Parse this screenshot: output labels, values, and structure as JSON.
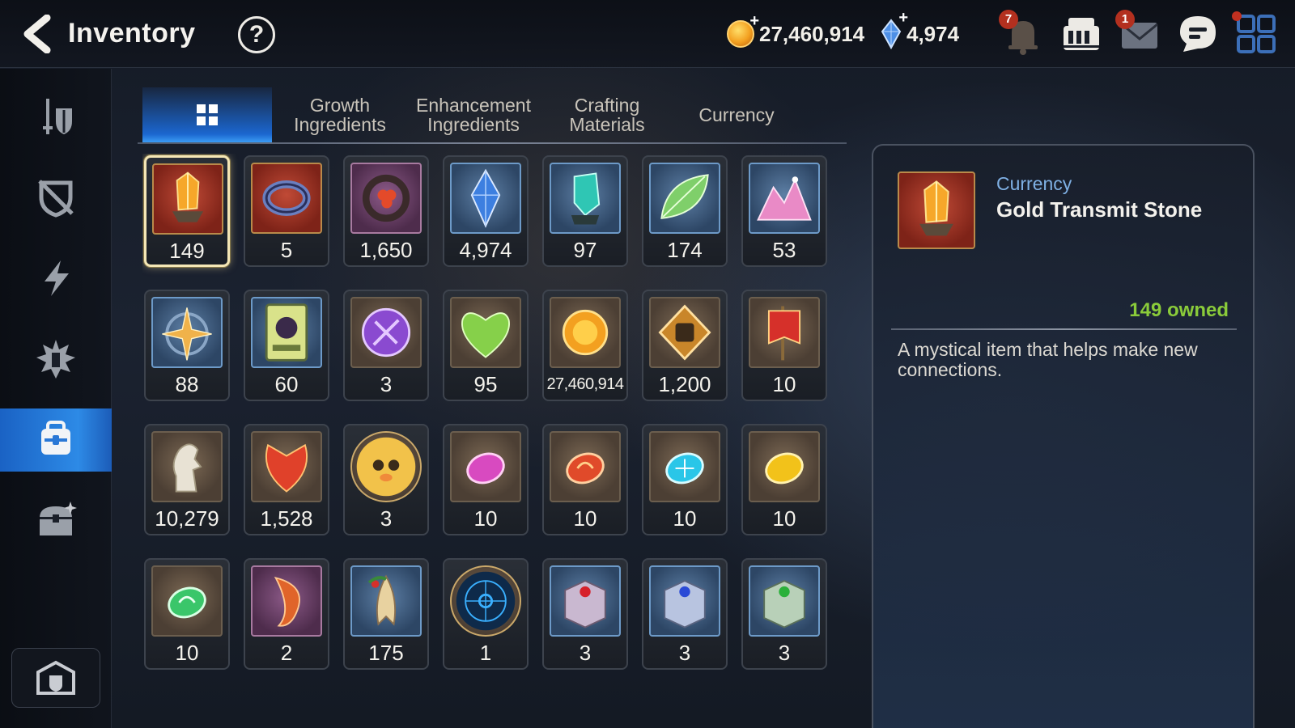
{
  "header": {
    "title": "Inventory",
    "help_label": "?",
    "gold": "27,460,914",
    "gems": "4,974",
    "notification_badge": "7",
    "mail_badge": "1"
  },
  "tabs": [
    {
      "label": "",
      "icon": "grid-icon",
      "active": true
    },
    {
      "label": "Growth\nIngredients"
    },
    {
      "label": "Enhancement\nIngredients"
    },
    {
      "label": "Crafting\nMaterials"
    },
    {
      "label": "Currency"
    }
  ],
  "sidebar": {
    "items": [
      "equipment-icon",
      "no-artifact-icon",
      "lightning-icon",
      "stigma-icon",
      "inventory-bag-icon",
      "chest-icon"
    ],
    "active_index": 4,
    "bottom": "storage-icon"
  },
  "items": [
    {
      "count": "149",
      "icon": "gold-transmit-stone",
      "bg": "red"
    },
    {
      "count": "5",
      "icon": "charm-ring",
      "bg": "red"
    },
    {
      "count": "1,650",
      "icon": "flower-ring",
      "bg": "purple"
    },
    {
      "count": "4,974",
      "icon": "blue-crystal",
      "bg": "blue"
    },
    {
      "count": "97",
      "icon": "teal-crystal",
      "bg": "blue"
    },
    {
      "count": "174",
      "icon": "leaf",
      "bg": "blue"
    },
    {
      "count": "53",
      "icon": "pink-crystal-pile",
      "bg": "blue"
    },
    {
      "count": "88",
      "icon": "star-medal",
      "bg": "blue"
    },
    {
      "count": "60",
      "icon": "summon-card",
      "bg": "blue"
    },
    {
      "count": "3",
      "icon": "purple-seal",
      "bg": "brown"
    },
    {
      "count": "95",
      "icon": "green-heart",
      "bg": "brown"
    },
    {
      "count": "27,460,914",
      "icon": "gold-coin",
      "bg": "brown"
    },
    {
      "count": "1,200",
      "icon": "fist-emblem",
      "bg": "brown"
    },
    {
      "count": "10",
      "icon": "red-banner",
      "bg": "brown"
    },
    {
      "count": "10,279",
      "icon": "white-knight",
      "bg": "brown"
    },
    {
      "count": "1,528",
      "icon": "red-leaf",
      "bg": "brown"
    },
    {
      "count": "3",
      "icon": "mascot-round",
      "bg": "round"
    },
    {
      "count": "10",
      "icon": "pink-gem",
      "bg": "brown"
    },
    {
      "count": "10",
      "icon": "red-swirl-gem",
      "bg": "brown"
    },
    {
      "count": "10",
      "icon": "cyan-snow-gem",
      "bg": "brown"
    },
    {
      "count": "10",
      "icon": "yellow-gem",
      "bg": "brown"
    },
    {
      "count": "10",
      "icon": "green-swirl-gem",
      "bg": "brown"
    },
    {
      "count": "2",
      "icon": "red-fox-tail",
      "bg": "purple"
    },
    {
      "count": "175",
      "icon": "ginseng",
      "bg": "blue"
    },
    {
      "count": "1",
      "icon": "blue-rune-orb",
      "bg": "round"
    },
    {
      "count": "3",
      "icon": "red-jewel-box",
      "bg": "blue"
    },
    {
      "count": "3",
      "icon": "blue-jewel-box",
      "bg": "blue"
    },
    {
      "count": "3",
      "icon": "green-jewel-box",
      "bg": "blue"
    }
  ],
  "selected_index": 0,
  "detail": {
    "category": "Currency",
    "name": "Gold Transmit Stone",
    "owned": "149 owned",
    "description": "A mystical item that helps make new connections."
  },
  "colors": {
    "accent_blue": "#1b66cf",
    "owned_green": "#8acb3a",
    "category_blue": "#7fb0e4"
  }
}
